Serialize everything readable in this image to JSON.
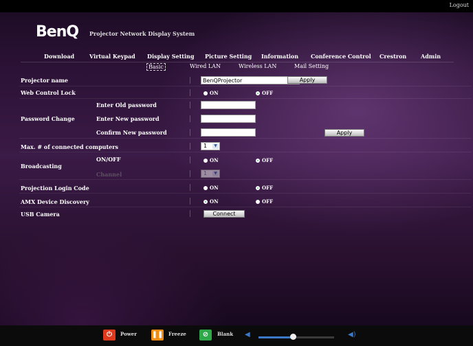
{
  "top": {
    "logout": "Logout"
  },
  "header": {
    "logo": "BenQ",
    "system_name": "Projector Network Display System"
  },
  "main_nav": [
    "Download",
    "Virtual Keypad",
    "Display Setting",
    "Picture Setting",
    "Information",
    "Conference Control",
    "Crestron",
    "Admin"
  ],
  "sub_nav": {
    "items": [
      "Basic",
      "Wired LAN",
      "Wireless LAN",
      "Mail Setting"
    ],
    "active": "Basic"
  },
  "form": {
    "projector_name": {
      "label": "Projector name",
      "value": "BenQProjector",
      "apply": "Apply"
    },
    "web_control_lock": {
      "label": "Web Control Lock",
      "on": "ON",
      "off": "OFF",
      "selected": "OFF"
    },
    "password_change": {
      "label": "Password Change",
      "old": "Enter Old password",
      "new": "Enter New password",
      "confirm": "Confirm New password",
      "apply": "Apply"
    },
    "max_computers": {
      "label": "Max. # of connected computers",
      "value": "1"
    },
    "broadcasting": {
      "label": "Broadcasting",
      "onoff_label": "ON/OFF",
      "on": "ON",
      "off": "OFF",
      "selected": "OFF",
      "channel_label": "Channel",
      "channel_value": "1"
    },
    "projection_login_code": {
      "label": "Projection Login Code",
      "on": "ON",
      "off": "OFF",
      "selected": "OFF"
    },
    "amx_discovery": {
      "label": "AMX Device Discovery",
      "on": "ON",
      "off": "OFF",
      "selected": "ON"
    },
    "usb_camera": {
      "label": "USB Camera",
      "button": "Connect"
    }
  },
  "bottom_bar": {
    "power": "Power",
    "freeze": "Freeze",
    "blank": "Blank",
    "volume_level": 0.45,
    "colors": {
      "power": "#e03a1e",
      "freeze": "#f08c14",
      "blank": "#2fa84a",
      "accent": "#3b78c8"
    }
  }
}
